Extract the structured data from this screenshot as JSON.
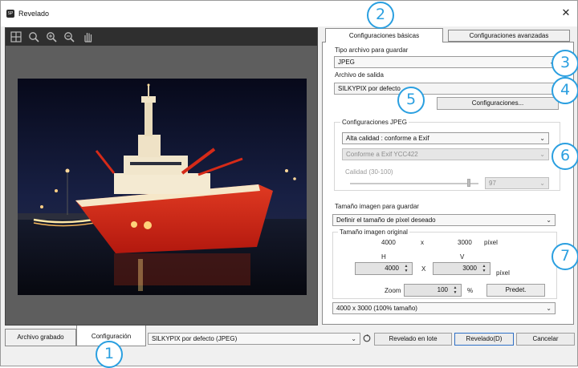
{
  "window": {
    "title": "Revelado",
    "app_icon_text": "SP",
    "close_glyph": "✕"
  },
  "preview": {
    "toolbar_icons": [
      "grid-icon",
      "zoom-icon",
      "zoom-in-icon",
      "zoom-out-icon",
      "hand-icon"
    ]
  },
  "tabs": {
    "basic": "Configuraciones básicas",
    "advanced": "Configuraciones avanzadas"
  },
  "save_type": {
    "label": "Tipo archivo para guardar",
    "value": "JPEG"
  },
  "output": {
    "label": "Archivo de salida",
    "value": "SILKYPIX por defecto",
    "config_button": "Configuraciones..."
  },
  "jpeg": {
    "group_label": "Configuraciones JPEG",
    "quality_mode": "Alta calidad : conforme a Exif",
    "color_mode": "Conforme a Exif YCC422",
    "quality_label": "Calidad (30-100)",
    "quality_value": "97"
  },
  "size": {
    "label": "Tamaño imagen para guardar",
    "mode": "Definir el tamaño de píxel deseado",
    "original_label": "Tamaño imagen original",
    "original_w": "4000",
    "x": "x",
    "original_h": "3000",
    "unit": "píxel",
    "h_label": "H",
    "v_label": "V",
    "h_value": "4000",
    "v_value": "3000",
    "x2": "X",
    "unit2": "píxel",
    "zoom_label": "Zoom",
    "zoom_value": "100",
    "percent": "%",
    "default_button": "Predet.",
    "preset": "4000 x 3000  (100% tamaño)"
  },
  "bottom": {
    "tab_saved": "Archivo grabado",
    "tab_config": "Configuración",
    "preset": "SILKYPIX por defecto (JPEG)",
    "batch_button": "Revelado en lote",
    "develop_button": "Revelado(D)",
    "cancel_button": "Cancelar"
  },
  "callouts": [
    "1",
    "2",
    "3",
    "4",
    "5",
    "6",
    "7"
  ],
  "colors": {
    "accent": "#2a9fe0",
    "default_border": "#2f6fc4"
  }
}
